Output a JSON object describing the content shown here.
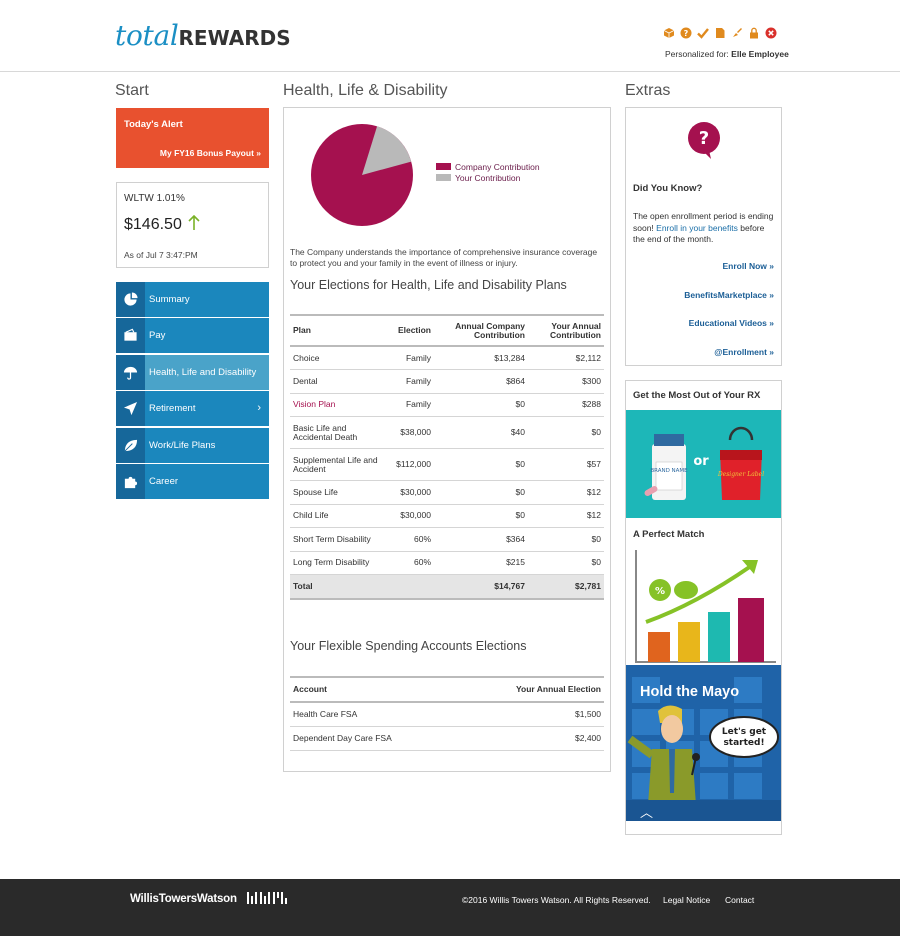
{
  "header": {
    "logo_total": "total",
    "logo_rewards": "REWARDS",
    "personalized_prefix": "Personalized for:",
    "personalized_name": "Elle Employee",
    "icons": [
      "box-icon",
      "help-icon",
      "check-icon",
      "document-icon",
      "brush-icon",
      "lock-icon",
      "close-icon"
    ],
    "icon_color": "#e08a1e",
    "close_color": "#d9302b"
  },
  "left": {
    "title": "Start",
    "alert": {
      "title": "Today's Alert",
      "link": "My FY16 Bonus Payout »"
    },
    "stock": {
      "name": "WLTW 1.01%",
      "price": "$146.50",
      "as_of": "As of Jul 7 3:47:PM"
    },
    "nav": [
      {
        "label": "Summary",
        "icon": "pie-chart-icon"
      },
      {
        "label": "Pay",
        "icon": "wallet-icon"
      },
      {
        "label": "Health, Life and Disability",
        "icon": "umbrella-icon"
      },
      {
        "label": "Retirement",
        "icon": "paper-plane-icon"
      },
      {
        "label": "Work/Life Plans",
        "icon": "leaf-icon"
      },
      {
        "label": "Career",
        "icon": "puzzle-icon"
      }
    ],
    "nav_chevron": "›"
  },
  "middle": {
    "title": "Health, Life & Disability",
    "pie": {
      "company_pct": 84,
      "your_pct": 16
    },
    "legend": [
      "Company Contribution",
      "Your Contribution"
    ],
    "colors": {
      "company": "#a5114f",
      "your": "#b9b9b9"
    },
    "description": "The Company understands the importance of comprehensive insurance coverage to protect you and your family in the event of illness or injury.",
    "elections_heading": "Your Elections for Health, Life and Disability Plans",
    "elections_headers": [
      "Plan",
      "Election",
      "Annual Company Contribution",
      "Your Annual Contribution"
    ],
    "elections": [
      [
        "Choice",
        "Family",
        "$13,284",
        "$2,112"
      ],
      [
        "Dental",
        "Family",
        "$864",
        "$300"
      ],
      [
        "Vision Plan",
        "Family",
        "$0",
        "$288"
      ],
      [
        "Basic Life and Accidental Death",
        "$38,000",
        "$40",
        "$0"
      ],
      [
        "Supplemental Life and Accident",
        "$112,000",
        "$0",
        "$57"
      ],
      [
        "Spouse Life",
        "$30,000",
        "$0",
        "$12"
      ],
      [
        "Child Life",
        "$30,000",
        "$0",
        "$12"
      ],
      [
        "Short Term Disability",
        "60%",
        "$364",
        "$0"
      ],
      [
        "Long Term Disability",
        "60%",
        "$215",
        "$0"
      ]
    ],
    "elections_total": [
      "Total",
      "",
      "$14,767",
      "$2,781"
    ],
    "fsa_heading": "Your Flexible Spending Accounts Elections",
    "fsa_headers": [
      "Account",
      "Your Annual Election"
    ],
    "fsa": [
      [
        "Health Care FSA",
        "$1,500"
      ],
      [
        "Dependent Day Care FSA",
        "$2,400"
      ]
    ]
  },
  "right": {
    "title": "Extras",
    "did_you_know": "Did You Know?",
    "para_before": "The open enrollment period is ending soon! ",
    "para_link": "Enroll in your benefits",
    "para_after": " before the end of the month.",
    "links": [
      "Enroll Now »",
      "BenefitsMarketplace »",
      "Educational Videos »",
      "@Enrollment »"
    ],
    "rx_title": "Get the Most Out of Your RX",
    "rx_brand": "BRAND NAME",
    "rx_or": "or",
    "rx_designer": "Designer Label",
    "match_title": "A Perfect Match",
    "mayo_title": "Hold the Mayo",
    "mayo_bubble": "Let's get started!",
    "up_arrow": "︿"
  },
  "footer": {
    "brand": "WillisTowersWatson",
    "copyright": "©2016 Willis Towers Watson. All Rights Reserved.",
    "legal": "Legal Notice",
    "contact": "Contact"
  }
}
